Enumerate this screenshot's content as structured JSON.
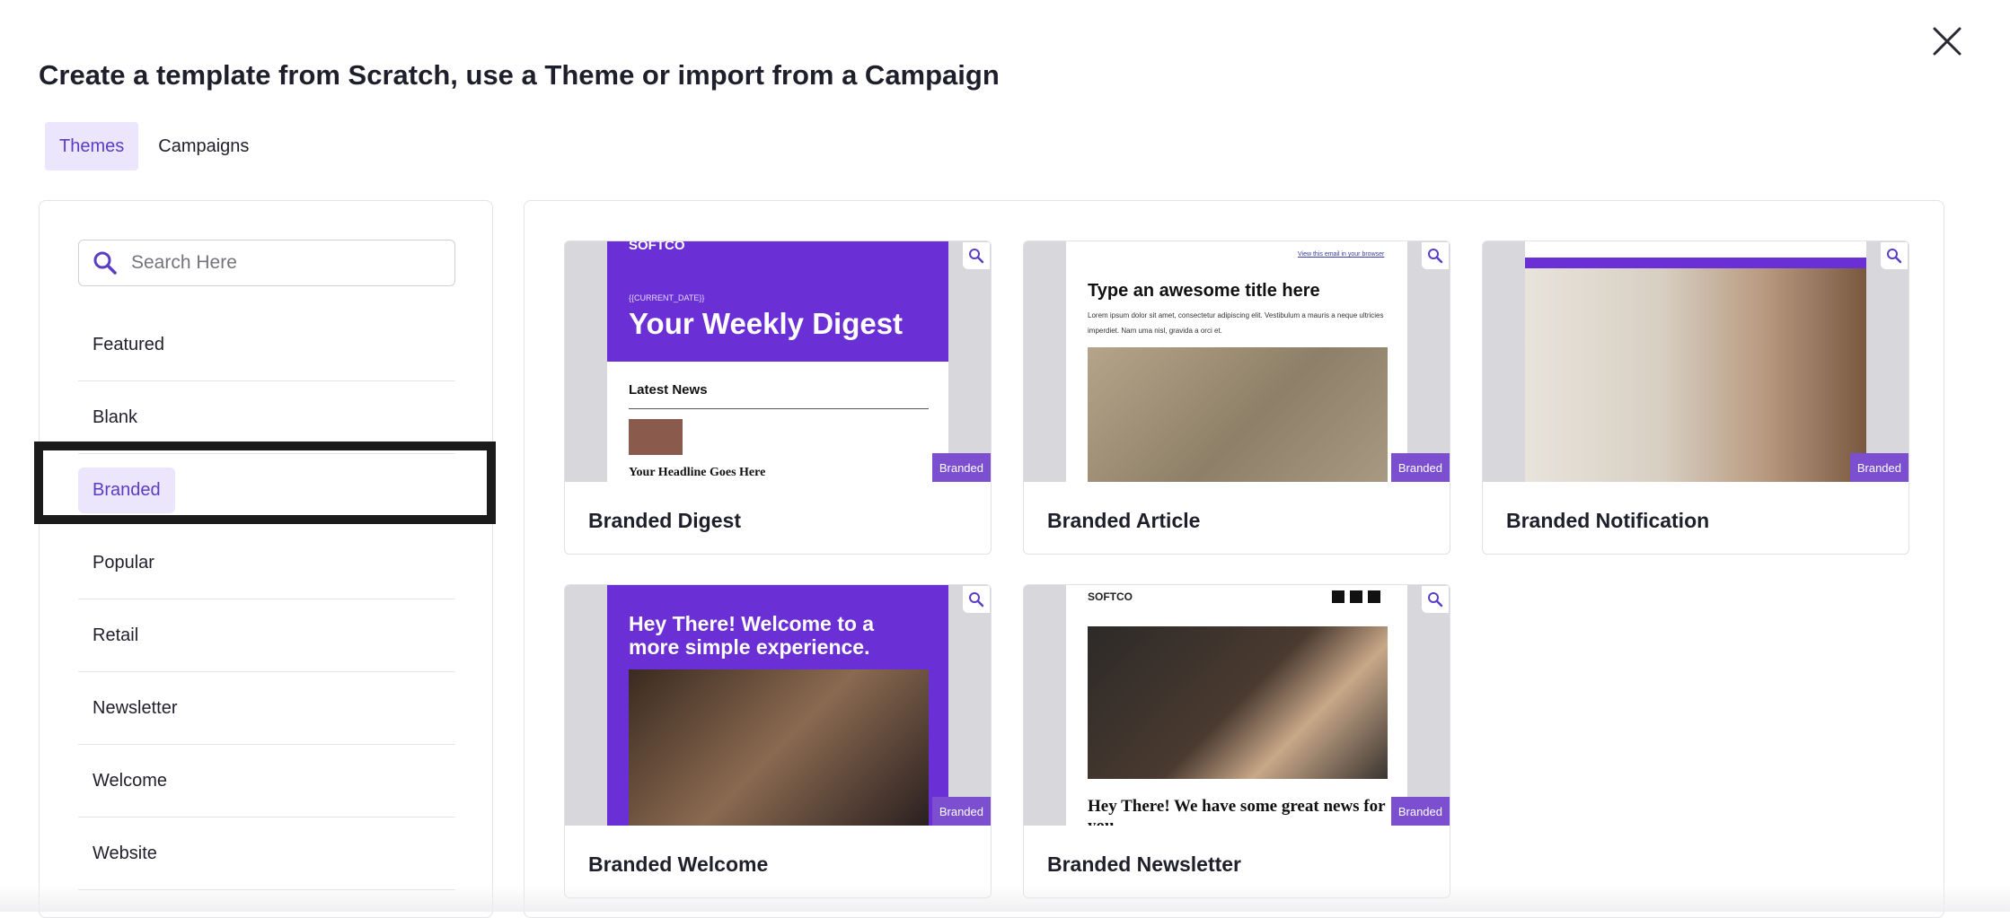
{
  "header": {
    "title": "Create a template from Scratch, use a Theme or import from a Campaign"
  },
  "tabs": [
    {
      "label": "Themes",
      "active": true
    },
    {
      "label": "Campaigns",
      "active": false
    }
  ],
  "search": {
    "placeholder": "Search Here",
    "value": ""
  },
  "categories": [
    {
      "label": "Featured"
    },
    {
      "label": "Blank"
    },
    {
      "label": "Branded",
      "selected": true
    },
    {
      "label": "Popular"
    },
    {
      "label": "Retail"
    },
    {
      "label": "Newsletter"
    },
    {
      "label": "Welcome"
    },
    {
      "label": "Website"
    }
  ],
  "colors": {
    "accent": "#5b3cc4",
    "accent_bg": "#ebe6fb",
    "badge": "#7b4fd0",
    "theme_purple": "#6b2fd6"
  },
  "templates": [
    {
      "name": "Branded Digest",
      "badge": "Branded",
      "preview": {
        "logo": "SOFTCO",
        "tag": "{{CURRENT_DATE}}",
        "headline": "Your Weekly Digest",
        "section": "Latest News",
        "item": "Your Headline Goes Here"
      }
    },
    {
      "name": "Branded Article",
      "badge": "Branded",
      "preview": {
        "view_link": "View this email in your browser",
        "headline": "Type an awesome title here",
        "body": "Lorem ipsum dolor sit amet, consectetur adipiscing elit. Vestibulum a mauris a neque ultricies imperdiet. Nam uma nisl, gravida a orci et."
      }
    },
    {
      "name": "Branded Notification",
      "badge": "Branded",
      "preview": {}
    },
    {
      "name": "Branded Welcome",
      "badge": "Branded",
      "preview": {
        "headline": "Hey There! Welcome to a more simple experience."
      }
    },
    {
      "name": "Branded Newsletter",
      "badge": "Branded",
      "preview": {
        "logo": "SOFTCO",
        "headline": "Hey There! We have some great news for you."
      }
    }
  ]
}
